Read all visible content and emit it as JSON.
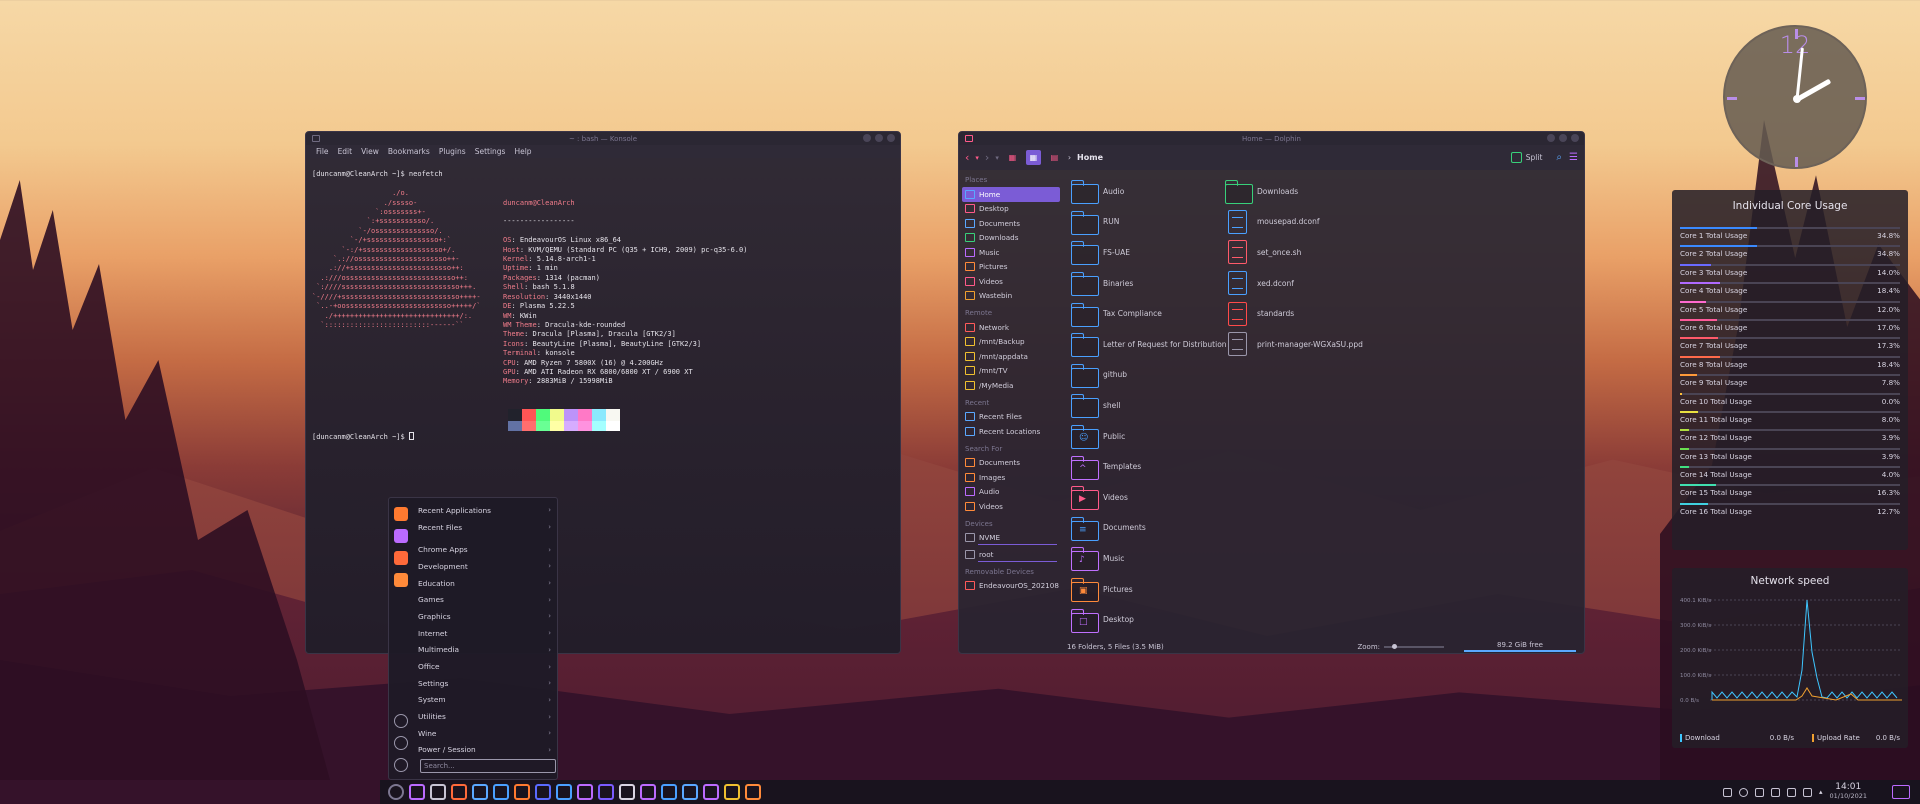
{
  "konsole": {
    "title": "~ : bash — Konsole",
    "menu": [
      "File",
      "Edit",
      "View",
      "Bookmarks",
      "Plugins",
      "Settings",
      "Help"
    ],
    "prompt1": "[duncanm@CleanArch ~]$ neofetch",
    "prompt2": "[duncanm@CleanArch ~]$ ",
    "ascii": "                   ./o.\n                 ./sssso-\n               `:osssssss+-\n             `:+sssssssssso/.\n           `-/ossssssssssssso/.\n         `-/+sssssssssssssssso+:`\n       `-:/+sssssssssssssssssso+/.\n     `.://osssssssssssssssssssso++-\n    .://+ssssssssssssssssssssssso++:\n  .:///ossssssssssssssssssssssssso++:\n `:////ssssssssssssssssssssssssssso+++.\n`-////+ssssssssssssssssssssssssssso++++-\n `..-+oosssssssssssssssssssssssso+++++/`\n   ./++++++++++++++++++++++++++++++/:.\n  `:::::::::::::::::::::::::------``",
    "userhost": "duncanm@CleanArch",
    "sep": "-----------------",
    "info": [
      {
        "k": "OS",
        "v": "EndeavourOS Linux x86_64"
      },
      {
        "k": "Host",
        "v": "KVM/QEMU (Standard PC (Q35 + ICH9, 2009) pc-q35-6.0)"
      },
      {
        "k": "Kernel",
        "v": "5.14.8-arch1-1"
      },
      {
        "k": "Uptime",
        "v": "1 min"
      },
      {
        "k": "Packages",
        "v": "1314 (pacman)"
      },
      {
        "k": "Shell",
        "v": "bash 5.1.8"
      },
      {
        "k": "Resolution",
        "v": "3440x1440"
      },
      {
        "k": "DE",
        "v": "Plasma 5.22.5"
      },
      {
        "k": "WM",
        "v": "KWin"
      },
      {
        "k": "WM Theme",
        "v": "Dracula-kde-rounded"
      },
      {
        "k": "Theme",
        "v": "Dracula [Plasma], Dracula [GTK2/3]"
      },
      {
        "k": "Icons",
        "v": "BeautyLine [Plasma], BeautyLine [GTK2/3]"
      },
      {
        "k": "Terminal",
        "v": "konsole"
      },
      {
        "k": "CPU",
        "v": "AMD Ryzen 7 5800X (16) @ 4.200GHz"
      },
      {
        "k": "GPU",
        "v": "AMD ATI Radeon RX 6800/6800 XT / 6900 XT"
      },
      {
        "k": "Memory",
        "v": "2883MiB / 15998MiB"
      }
    ],
    "palette_top": [
      "#21222c",
      "#ff5555",
      "#50fa7b",
      "#f1fa8c",
      "#bd93f9",
      "#ff79c6",
      "#8be9fd",
      "#f8f8f2"
    ],
    "palette_bottom": [
      "#6272a4",
      "#ff6e6e",
      "#69ff94",
      "#ffffa5",
      "#d6acff",
      "#ff92df",
      "#a4ffff",
      "#ffffff"
    ]
  },
  "dolphin": {
    "title": "Home — Dolphin",
    "breadcrumb": "Home",
    "split_label": "Split",
    "sections": {
      "places": "Places",
      "remote": "Remote",
      "recent": "Recent",
      "search": "Search For",
      "devices": "Devices",
      "removable": "Removable Devices"
    },
    "places": [
      {
        "label": "Home",
        "color": "#5aa8ff",
        "active": true
      },
      {
        "label": "Desktop",
        "color": "#ff5a8a"
      },
      {
        "label": "Documents",
        "color": "#5aa8ff"
      },
      {
        "label": "Downloads",
        "color": "#38d07a"
      },
      {
        "label": "Music",
        "color": "#bb6bff"
      },
      {
        "label": "Pictures",
        "color": "#ff8a3a"
      },
      {
        "label": "Videos",
        "color": "#ff5a8a"
      },
      {
        "label": "Wastebin",
        "color": "#f0a030"
      }
    ],
    "remote": [
      {
        "label": "Network",
        "color": "#ff5a5a"
      },
      {
        "label": "/mnt/Backup",
        "color": "#f0c030"
      },
      {
        "label": "/mnt/appdata",
        "color": "#f0c030"
      },
      {
        "label": "/mnt/TV",
        "color": "#f0c030"
      },
      {
        "label": "/MyMedia",
        "color": "#f0c030"
      }
    ],
    "recent": [
      {
        "label": "Recent Files",
        "color": "#5aa8ff"
      },
      {
        "label": "Recent Locations",
        "color": "#5aa8ff"
      }
    ],
    "search": [
      {
        "label": "Documents",
        "color": "#ff8a3a"
      },
      {
        "label": "Images",
        "color": "#ff8a3a"
      },
      {
        "label": "Audio",
        "color": "#bb6bff"
      },
      {
        "label": "Videos",
        "color": "#ff8a3a"
      }
    ],
    "devices": [
      {
        "label": "NVME",
        "color": "#9a96aa"
      },
      {
        "label": "root",
        "color": "#9a96aa"
      }
    ],
    "removable": [
      {
        "label": "EndeavourOS_202108",
        "color": "#ff5a5a"
      }
    ],
    "col1": [
      {
        "label": "Audio",
        "color": "#4aa0ff",
        "glyph": ""
      },
      {
        "label": "RUN",
        "color": "#4aa0ff",
        "glyph": ""
      },
      {
        "label": "FS-UAE",
        "color": "#4aa0ff",
        "glyph": ""
      },
      {
        "label": "Binaries",
        "color": "#4aa0ff",
        "glyph": ""
      },
      {
        "label": "Tax Compliance",
        "color": "#4aa0ff",
        "glyph": ""
      },
      {
        "label": "Letter of Request for Distribution",
        "color": "#4aa0ff",
        "glyph": ""
      },
      {
        "label": "github",
        "color": "#4aa0ff",
        "glyph": ""
      },
      {
        "label": "shell",
        "color": "#4aa0ff",
        "glyph": ""
      },
      {
        "label": "Public",
        "color": "#4aa0ff",
        "glyph": "☺"
      },
      {
        "label": "Templates",
        "color": "#c070ff",
        "glyph": "^"
      },
      {
        "label": "Videos",
        "color": "#ff5a8a",
        "glyph": "▶"
      },
      {
        "label": "Documents",
        "color": "#4aa0ff",
        "glyph": "≡"
      },
      {
        "label": "Music",
        "color": "#c070ff",
        "glyph": "♪"
      },
      {
        "label": "Pictures",
        "color": "#ff8a3a",
        "glyph": "▣"
      },
      {
        "label": "Desktop",
        "color": "#c070ff",
        "glyph": "□"
      }
    ],
    "col2": [
      {
        "label": "Downloads",
        "color": "#38d07a",
        "type": "folder"
      },
      {
        "label": "mousepad.dconf",
        "color": "#4aa0ff",
        "type": "doc"
      },
      {
        "label": "set_once.sh",
        "color": "#ff5a6a",
        "type": "doc"
      },
      {
        "label": "xed.dconf",
        "color": "#4aa0ff",
        "type": "doc"
      },
      {
        "label": "standards",
        "color": "#ff4a4a",
        "type": "doc"
      },
      {
        "label": "print-manager-WGXaSU.ppd",
        "color": "#9a96aa",
        "type": "doc"
      }
    ],
    "status": "16 Folders, 5 Files (3.5 MiB)",
    "zoom_label": "Zoom:",
    "free": "89.2 GiB free"
  },
  "appmenu": {
    "items_top": [
      "Recent Applications",
      "Recent Files"
    ],
    "items": [
      "Chrome Apps",
      "Development",
      "Education",
      "Games",
      "Graphics",
      "Internet",
      "Multimedia",
      "Office",
      "Settings",
      "System",
      "Utilities",
      "Wine",
      "Power / Session"
    ],
    "arrow": "›",
    "search_placeholder": "Search..."
  },
  "taskbar": {
    "time": "14:01",
    "date": "01/10/2021",
    "apps": [
      "#7c7690",
      "#bb6bff",
      "#c8c4d4",
      "#ff6a3a",
      "#5aa8ff",
      "#4aa0ff",
      "#ff7a30",
      "#5a6aff",
      "#4aa0ff",
      "#bb6bff",
      "#7a5cff",
      "#d8d4e2",
      "#bb6bff",
      "#4aa0ff",
      "#5aa8ff",
      "#bb6bff",
      "#f0c030",
      "#ff8a3a"
    ]
  },
  "clock": {
    "numeral": "12",
    "hour": 2.0,
    "minute": 1
  },
  "cores": {
    "title": "Individual Core Usage",
    "items": [
      {
        "label": "Core 1 Total Usage",
        "value": "34.8%",
        "pct": 34.8,
        "color": "#3a8aff"
      },
      {
        "label": "Core 2 Total Usage",
        "value": "34.8%",
        "pct": 34.8,
        "color": "#3a8aff"
      },
      {
        "label": "Core 3 Total Usage",
        "value": "14.0%",
        "pct": 14.0,
        "color": "#6a6aff"
      },
      {
        "label": "Core 4 Total Usage",
        "value": "18.4%",
        "pct": 18.4,
        "color": "#b06aff"
      },
      {
        "label": "Core 5 Total Usage",
        "value": "12.0%",
        "pct": 12.0,
        "color": "#ff6ad0"
      },
      {
        "label": "Core 6 Total Usage",
        "value": "17.0%",
        "pct": 17.0,
        "color": "#ff5a9a"
      },
      {
        "label": "Core 7 Total Usage",
        "value": "17.3%",
        "pct": 17.3,
        "color": "#ff5a6a"
      },
      {
        "label": "Core 8 Total Usage",
        "value": "18.4%",
        "pct": 18.4,
        "color": "#ff6a4a"
      },
      {
        "label": "Core 9 Total Usage",
        "value": "7.8%",
        "pct": 7.8,
        "color": "#ff9a3a"
      },
      {
        "label": "Core 10 Total Usage",
        "value": "0.0%",
        "pct": 0.0,
        "color": "#ffc03a"
      },
      {
        "label": "Core 11 Total Usage",
        "value": "8.0%",
        "pct": 8.0,
        "color": "#e8e040"
      },
      {
        "label": "Core 12 Total Usage",
        "value": "3.9%",
        "pct": 3.9,
        "color": "#b0e040"
      },
      {
        "label": "Core 13 Total Usage",
        "value": "3.9%",
        "pct": 3.9,
        "color": "#6ae050"
      },
      {
        "label": "Core 14 Total Usage",
        "value": "4.0%",
        "pct": 4.0,
        "color": "#40e080"
      },
      {
        "label": "Core 15 Total Usage",
        "value": "16.3%",
        "pct": 16.3,
        "color": "#40e0b0"
      },
      {
        "label": "Core 16 Total Usage",
        "value": "12.7%",
        "pct": 12.7,
        "color": "#40d0e0"
      }
    ]
  },
  "network": {
    "title": "Network speed",
    "yticks": [
      "400.1 KiB/s",
      "300.0 KiB/s",
      "200.0 KiB/s",
      "100.0 KiB/s",
      "0.0 B/s"
    ],
    "download_label": "Download",
    "download_value": "0.0 B/s",
    "upload_label": "Upload Rate",
    "upload_value": "0.0 B/s"
  }
}
